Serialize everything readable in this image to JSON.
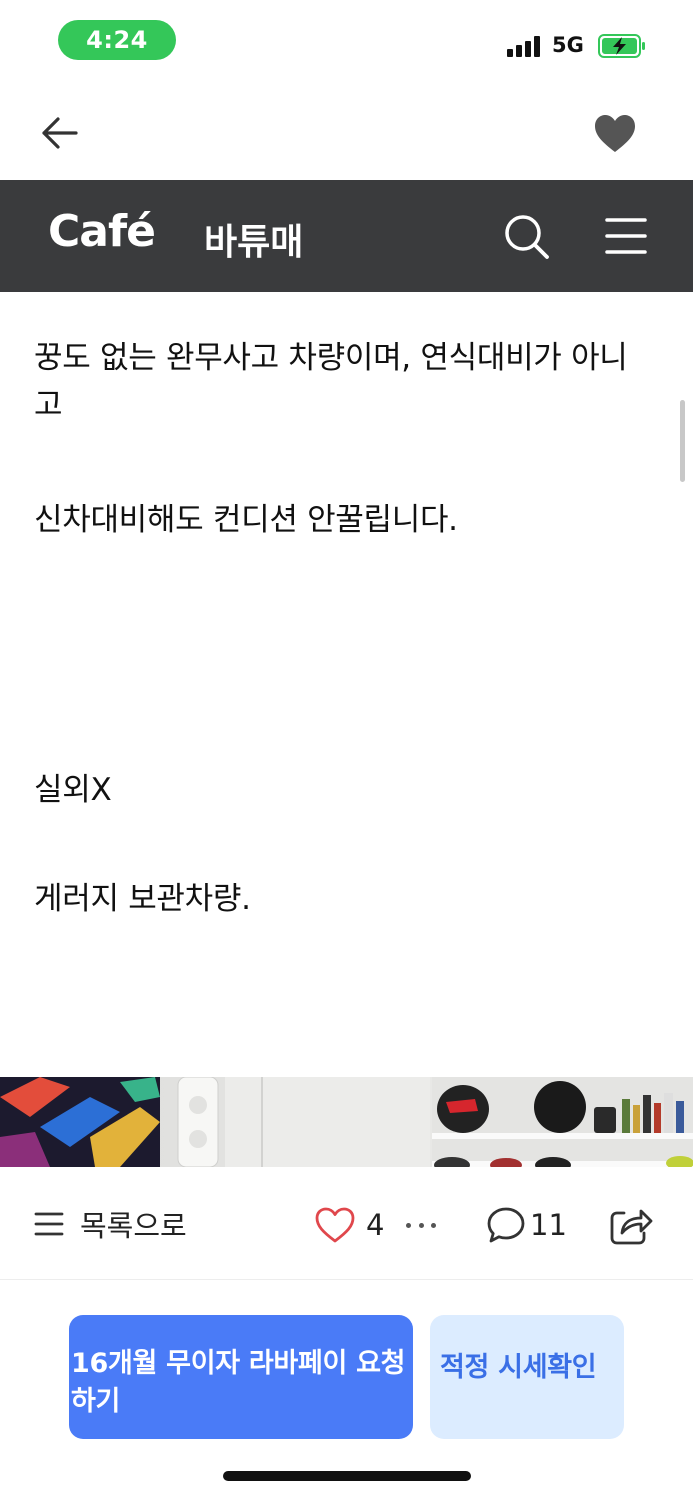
{
  "status_bar": {
    "time": "4:24",
    "network": "5G",
    "time_pill_color": "#34c759",
    "battery_color": "#34c759",
    "battery_charging": true
  },
  "top_nav": {
    "back_icon": "arrow-left-icon",
    "favorite_icon": "heart-filled-icon"
  },
  "cafe_header": {
    "logo": "Café",
    "cafe_name": "바튜매",
    "background_color": "#3a3b3d",
    "search_icon": "search-icon",
    "menu_icon": "hamburger-menu-icon"
  },
  "article": {
    "paragraphs": [
      "꿍도 없는 완무사고 차량이며, 연식대비가 아니고",
      "신차대비해도 컨디션 안꿀립니다.",
      "실외X",
      "게러지 보관차량."
    ]
  },
  "action_bar": {
    "list_label": "목록으로",
    "like_count": "4",
    "comment_count": "11",
    "like_color": "#e0474c"
  },
  "cta": {
    "primary_label": "16개월 무이자 라바페이 요청하기",
    "secondary_label": "적정 시세확인",
    "primary_color": "#4a7bf7",
    "secondary_color": "#dcecff"
  }
}
